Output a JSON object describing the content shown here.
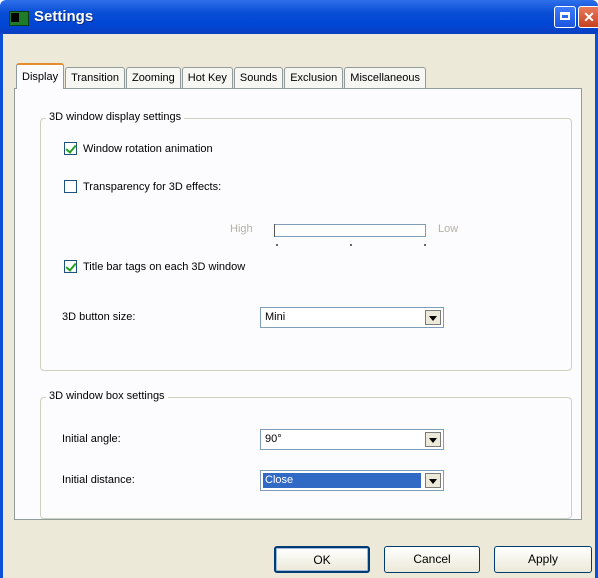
{
  "window": {
    "title": "Settings"
  },
  "tabs": [
    {
      "label": "Display",
      "active": true
    },
    {
      "label": "Transition",
      "active": false
    },
    {
      "label": "Zooming",
      "active": false
    },
    {
      "label": "Hot Key",
      "active": false
    },
    {
      "label": "Sounds",
      "active": false
    },
    {
      "label": "Exclusion",
      "active": false
    },
    {
      "label": "Miscellaneous",
      "active": false
    }
  ],
  "display_group": {
    "label": "3D window display settings",
    "window_rotation_animation": {
      "label": "Window rotation animation",
      "checked": true
    },
    "transparency": {
      "label": "Transparency for 3D effects:",
      "checked": false
    },
    "transparency_slider": {
      "high_label": "High",
      "low_label": "Low"
    },
    "title_bar_tags": {
      "label": "Title bar tags on each 3D window",
      "checked": true
    },
    "button_size": {
      "label": "3D button size:",
      "value": "Mini"
    }
  },
  "box_group": {
    "label": "3D window box settings",
    "initial_angle": {
      "label": "Initial angle:",
      "value": "90°"
    },
    "initial_distance": {
      "label": "Initial distance:",
      "value": "Close"
    }
  },
  "buttons": {
    "ok": "OK",
    "cancel": "Cancel",
    "apply": "Apply"
  },
  "colors": {
    "titlebar": "#0a4fd6",
    "selection": "#316ac5",
    "checkmark": "#21a121",
    "active_tab_accent": "#e68b2c"
  }
}
